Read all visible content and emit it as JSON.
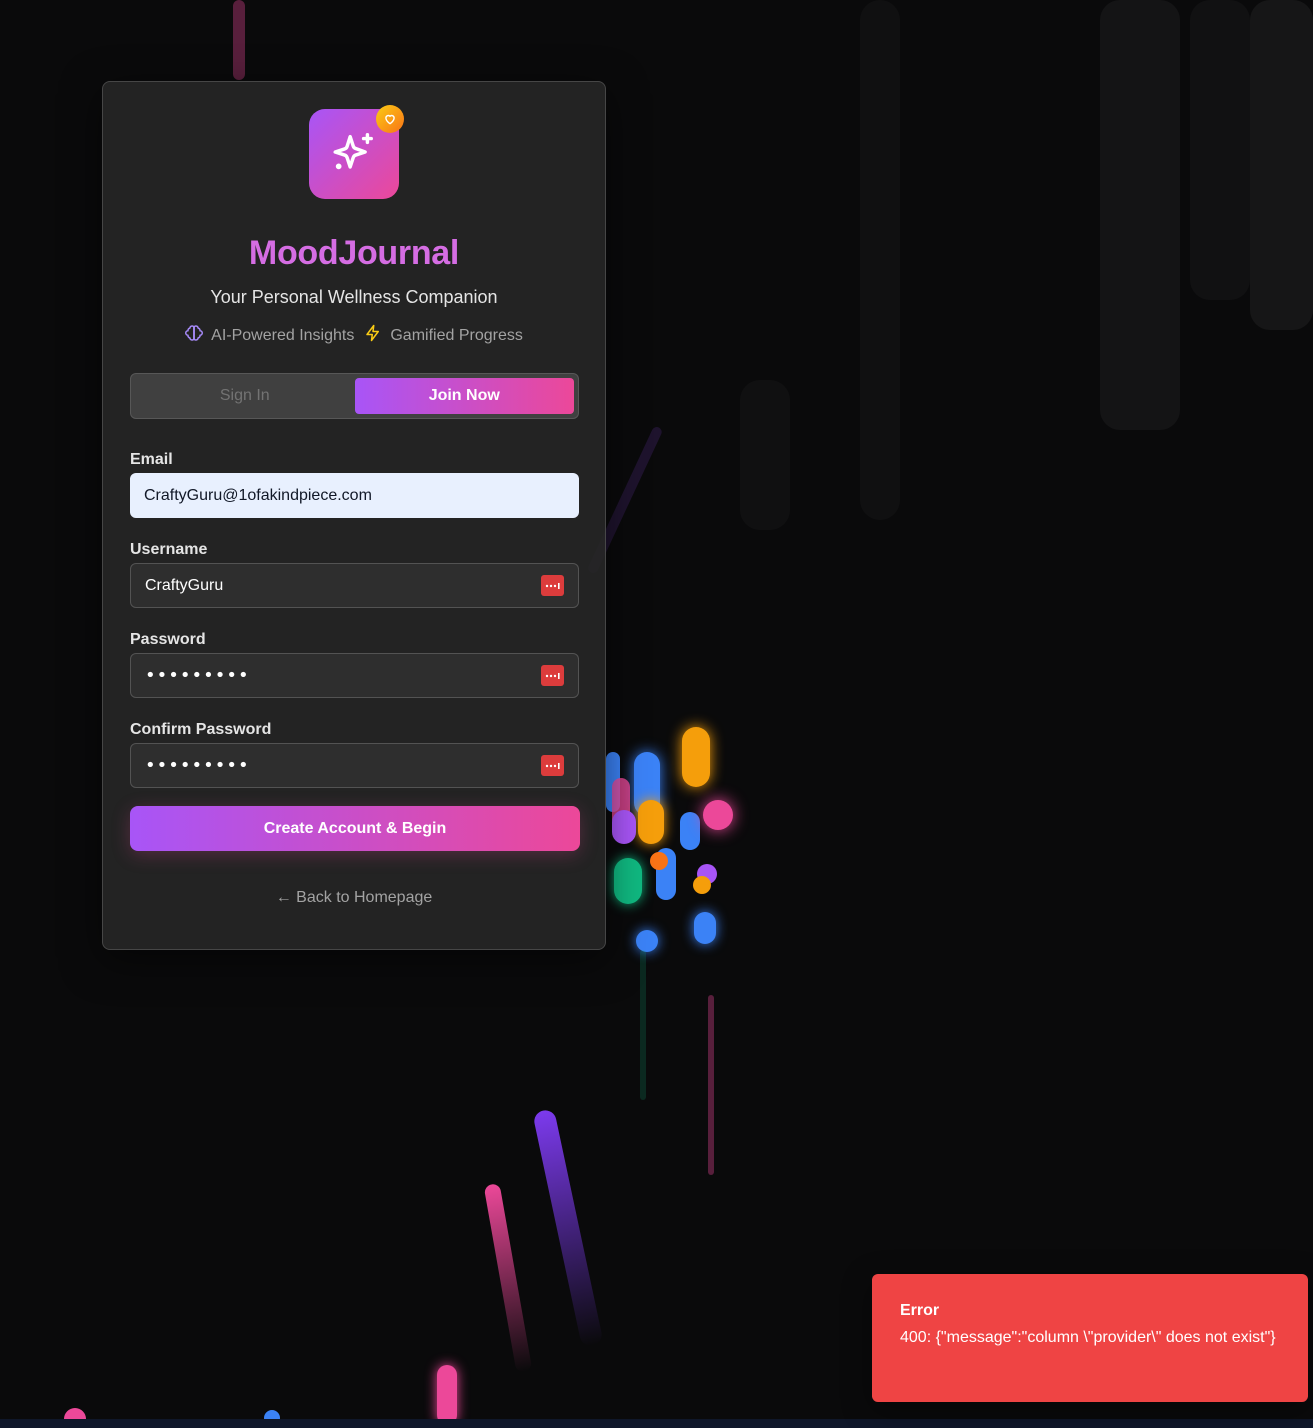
{
  "app": {
    "title": "MoodJournal",
    "tagline": "Your Personal Wellness Companion",
    "features": [
      {
        "icon": "brain-icon",
        "label": "AI-Powered Insights",
        "color": "#a78bfa"
      },
      {
        "icon": "lightning-icon",
        "label": "Gamified Progress",
        "color": "#facc15"
      }
    ]
  },
  "tabs": [
    {
      "label": "Sign In",
      "active": false
    },
    {
      "label": "Join Now",
      "active": true
    }
  ],
  "form": {
    "email": {
      "label": "Email",
      "value": "CraftyGuru@1ofakindpiece.com"
    },
    "username": {
      "label": "Username",
      "value": "CraftyGuru"
    },
    "password": {
      "label": "Password",
      "value": "•••••••••"
    },
    "confirm_password": {
      "label": "Confirm Password",
      "value": "•••••••••"
    },
    "submit_label": "Create Account & Begin"
  },
  "back_link": "← Back to Homepage",
  "toast": {
    "title": "Error",
    "message": "400: {\"message\":\"column \\\"provider\\\" does not exist\"}"
  },
  "colors": {
    "accent_start": "#a855f7",
    "accent_end": "#ec4899",
    "title": "#d56de3",
    "error": "#ef4444",
    "password_manager": "#dc3c3c"
  }
}
